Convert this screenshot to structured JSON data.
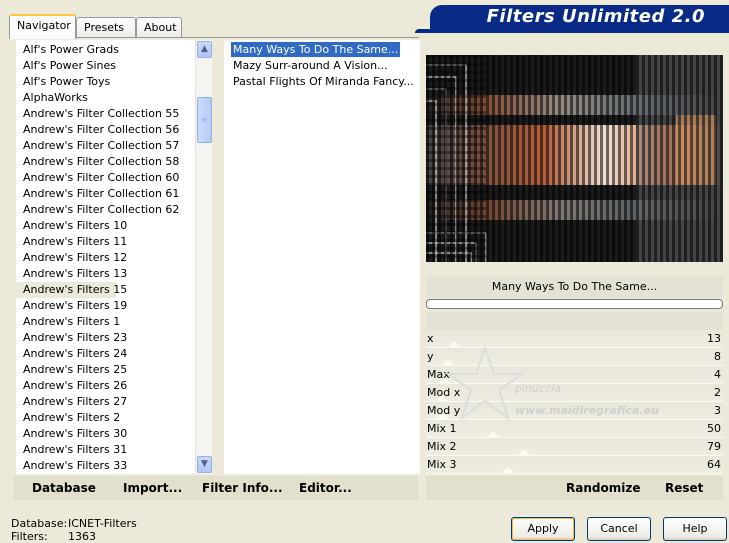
{
  "banner": {
    "title": "Filters Unlimited 2.0"
  },
  "tabs": [
    {
      "label": "Navigator"
    },
    {
      "label": "Presets"
    },
    {
      "label": "About"
    }
  ],
  "categories": [
    "Alf's Power Grads",
    "Alf's Power Sines",
    "Alf's Power Toys",
    "AlphaWorks",
    "Andrew's Filter Collection 55",
    "Andrew's Filter Collection 56",
    "Andrew's Filter Collection 57",
    "Andrew's Filter Collection 58",
    "Andrew's Filter Collection 60",
    "Andrew's Filter Collection 61",
    "Andrew's Filter Collection 62",
    "Andrew's Filters 10",
    "Andrew's Filters 11",
    "Andrew's Filters 12",
    "Andrew's Filters 13",
    "Andrew's Filters 15",
    "Andrew's Filters 19",
    "Andrew's Filters 1",
    "Andrew's Filters 23",
    "Andrew's Filters 24",
    "Andrew's Filters 25",
    "Andrew's Filters 26",
    "Andrew's Filters 27",
    "Andrew's Filters 2",
    "Andrew's Filters 30",
    "Andrew's Filters 31",
    "Andrew's Filters 33"
  ],
  "selected_category": "Andrew's Filters 15",
  "filters": [
    "Many Ways To Do The Same...",
    "Mazy Surr-around A Vision...",
    "Pastal Flights Of Miranda Fancy..."
  ],
  "selected_filter": "Many Ways To Do The Same...",
  "preview_label": "Many Ways To Do The Same...",
  "params": [
    {
      "name": "x",
      "value": "13",
      "level": 13
    },
    {
      "name": "y",
      "value": "8",
      "level": 8
    },
    {
      "name": "Max",
      "value": "4",
      "level": 4
    },
    {
      "name": "Mod x",
      "value": "2",
      "level": 2
    },
    {
      "name": "Mod y",
      "value": "3",
      "level": 3
    },
    {
      "name": "Mix 1",
      "value": "50",
      "level": 50
    },
    {
      "name": "Mix 2",
      "value": "79",
      "level": 79
    },
    {
      "name": "Mix 3",
      "value": "64",
      "level": 64
    }
  ],
  "watermark": {
    "line1": "pinuccia",
    "line2": "www.maidiregrafica.eu"
  },
  "bottom_buttons": {
    "database": "Database",
    "import": "Import...",
    "filter_info": "Filter Info...",
    "editor": "Editor...",
    "randomize": "Randomize",
    "reset": "Reset"
  },
  "status": {
    "database_label": "Database:",
    "database_value": "ICNET-Filters",
    "filters_label": "Filters:",
    "filters_value": "1363"
  },
  "dialog_buttons": {
    "apply": "Apply",
    "cancel": "Cancel",
    "help": "Help"
  },
  "colors": {
    "banner": "#0a2a88",
    "selection": "#316ac5",
    "panel": "#ece9d8"
  }
}
